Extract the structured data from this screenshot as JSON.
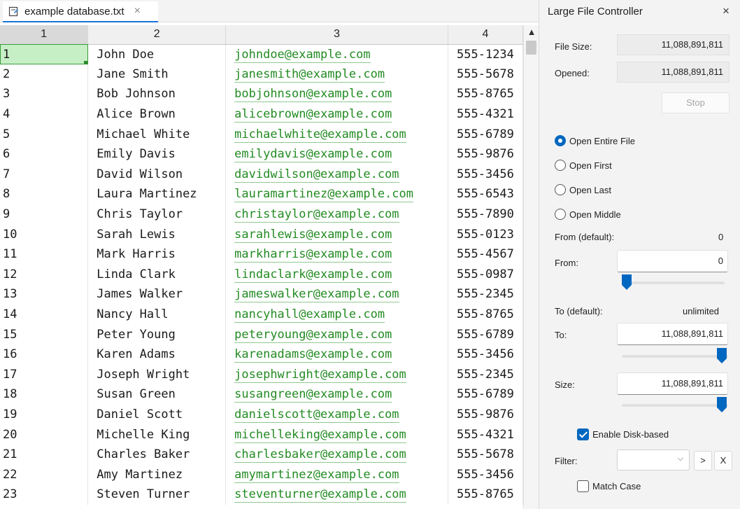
{
  "editor": {
    "tab_title": "example database.txt",
    "tab_close": "×",
    "columns": [
      "1",
      "2",
      "3",
      "4"
    ],
    "rows": [
      [
        "1",
        "John Doe",
        "johndoe@example.com",
        "555-1234"
      ],
      [
        "2",
        "Jane Smith",
        "janesmith@example.com",
        "555-5678"
      ],
      [
        "3",
        "Bob Johnson",
        "bobjohnson@example.com",
        "555-8765"
      ],
      [
        "4",
        "Alice Brown",
        "alicebrown@example.com",
        "555-4321"
      ],
      [
        "5",
        "Michael White",
        "michaelwhite@example.com",
        "555-6789"
      ],
      [
        "6",
        "Emily Davis",
        "emilydavis@example.com",
        "555-9876"
      ],
      [
        "7",
        "David Wilson",
        "davidwilson@example.com",
        "555-3456"
      ],
      [
        "8",
        "Laura Martinez",
        "lauramartinez@example.com",
        "555-6543"
      ],
      [
        "9",
        "Chris Taylor",
        "christaylor@example.com",
        "555-7890"
      ],
      [
        "10",
        "Sarah Lewis",
        "sarahlewis@example.com",
        "555-0123"
      ],
      [
        "11",
        "Mark Harris",
        "markharris@example.com",
        "555-4567"
      ],
      [
        "12",
        "Linda Clark",
        "lindaclark@example.com",
        "555-0987"
      ],
      [
        "13",
        "James Walker",
        "jameswalker@example.com",
        "555-2345"
      ],
      [
        "14",
        "Nancy Hall",
        "nancyhall@example.com",
        "555-8765"
      ],
      [
        "15",
        "Peter Young",
        "peteryoung@example.com",
        "555-6789"
      ],
      [
        "16",
        "Karen Adams",
        "karenadams@example.com",
        "555-3456"
      ],
      [
        "17",
        "Joseph Wright",
        "josephwright@example.com",
        "555-2345"
      ],
      [
        "18",
        "Susan Green",
        "susangreen@example.com",
        "555-6789"
      ],
      [
        "19",
        "Daniel Scott",
        "danielscott@example.com",
        "555-9876"
      ],
      [
        "20",
        "Michelle King",
        "michelleking@example.com",
        "555-4321"
      ],
      [
        "21",
        "Charles Baker",
        "charlesbaker@example.com",
        "555-5678"
      ],
      [
        "22",
        "Amy Martinez",
        "amymartinez@example.com",
        "555-3456"
      ],
      [
        "23",
        "Steven Turner",
        "steventurner@example.com",
        "555-8765"
      ]
    ]
  },
  "panel": {
    "title": "Large File Controller",
    "close": "×",
    "file_size_label": "File Size:",
    "file_size_value": "11,088,891,811",
    "opened_label": "Opened:",
    "opened_value": "11,088,891,811",
    "stop_label": "Stop",
    "radio_options": [
      "Open Entire File",
      "Open First",
      "Open Last",
      "Open Middle"
    ],
    "from_default_label": "From (default):",
    "from_default_value": "0",
    "from_label": "From:",
    "from_value": "0",
    "to_default_label": "To (default):",
    "to_default_value": "unlimited",
    "to_label": "To:",
    "to_value": "11,088,891,811",
    "size_label": "Size:",
    "size_value": "11,088,891,811",
    "enable_disk_label": "Enable Disk-based",
    "filter_label": "Filter:",
    "filter_next": ">",
    "filter_clear": "X",
    "match_case_label": "Match Case"
  }
}
